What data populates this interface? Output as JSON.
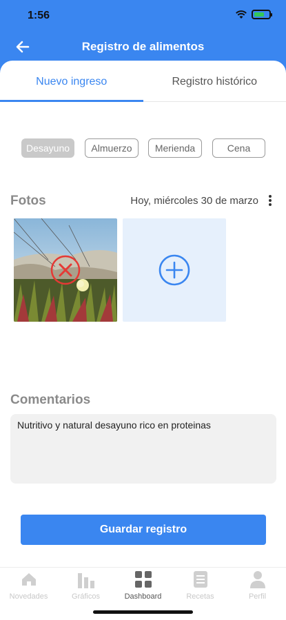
{
  "status_bar": {
    "time": "1:56"
  },
  "header": {
    "title": "Registro de alimentos"
  },
  "tabs": [
    {
      "label": "Nuevo ingreso",
      "active": true
    },
    {
      "label": "Registro histórico",
      "active": false
    }
  ],
  "meals": [
    {
      "label": "Desayuno",
      "selected": true
    },
    {
      "label": "Almuerzo",
      "selected": false
    },
    {
      "label": "Merienda",
      "selected": false
    },
    {
      "label": "Cena",
      "selected": false
    }
  ],
  "photos": {
    "title": "Fotos",
    "date": "Hoy, miércoles 30 de marzo"
  },
  "comments": {
    "title": "Comentarios",
    "value": "Nutritivo y natural desayuno rico en proteinas"
  },
  "save_button": {
    "label": "Guardar registro"
  },
  "bottom_nav": [
    {
      "label": "Novedades",
      "icon": "home-icon",
      "active": false
    },
    {
      "label": "Gráficos",
      "icon": "bar-chart-icon",
      "active": false
    },
    {
      "label": "Dashboard",
      "icon": "grid-icon",
      "active": true
    },
    {
      "label": "Recetas",
      "icon": "recipe-icon",
      "active": false
    },
    {
      "label": "Perfil",
      "icon": "user-icon",
      "active": false
    }
  ],
  "colors": {
    "primary": "#3a86f0",
    "chip_selected": "#c9c9c9",
    "add_photo_bg": "#e6f0fc",
    "delete_red": "#e53935"
  }
}
